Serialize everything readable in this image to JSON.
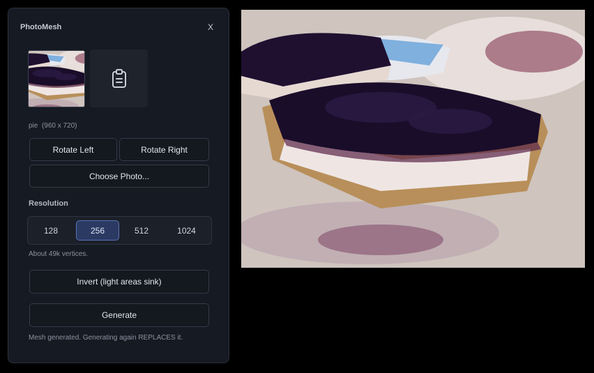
{
  "app": {
    "title": "PhotoMesh",
    "close_label": "X"
  },
  "photo": {
    "name": "pie",
    "dimensions": "(960 x 720)"
  },
  "paste_icon": "clipboard-icon",
  "buttons": {
    "rotate_left": "Rotate Left",
    "rotate_right": "Rotate Right",
    "choose_photo": "Choose Photo...",
    "invert": "Invert (light areas sink)",
    "generate": "Generate"
  },
  "resolution": {
    "label": "Resolution",
    "options": [
      "128",
      "256",
      "512",
      "1024"
    ],
    "selected": "256",
    "note": "About 49k vertices."
  },
  "status": "Mesh generated. Generating again REPLACES it.",
  "colors": {
    "panel_bg": "#161a22",
    "accent": "#5b72b8",
    "selected_bg": "#2b3a62"
  }
}
